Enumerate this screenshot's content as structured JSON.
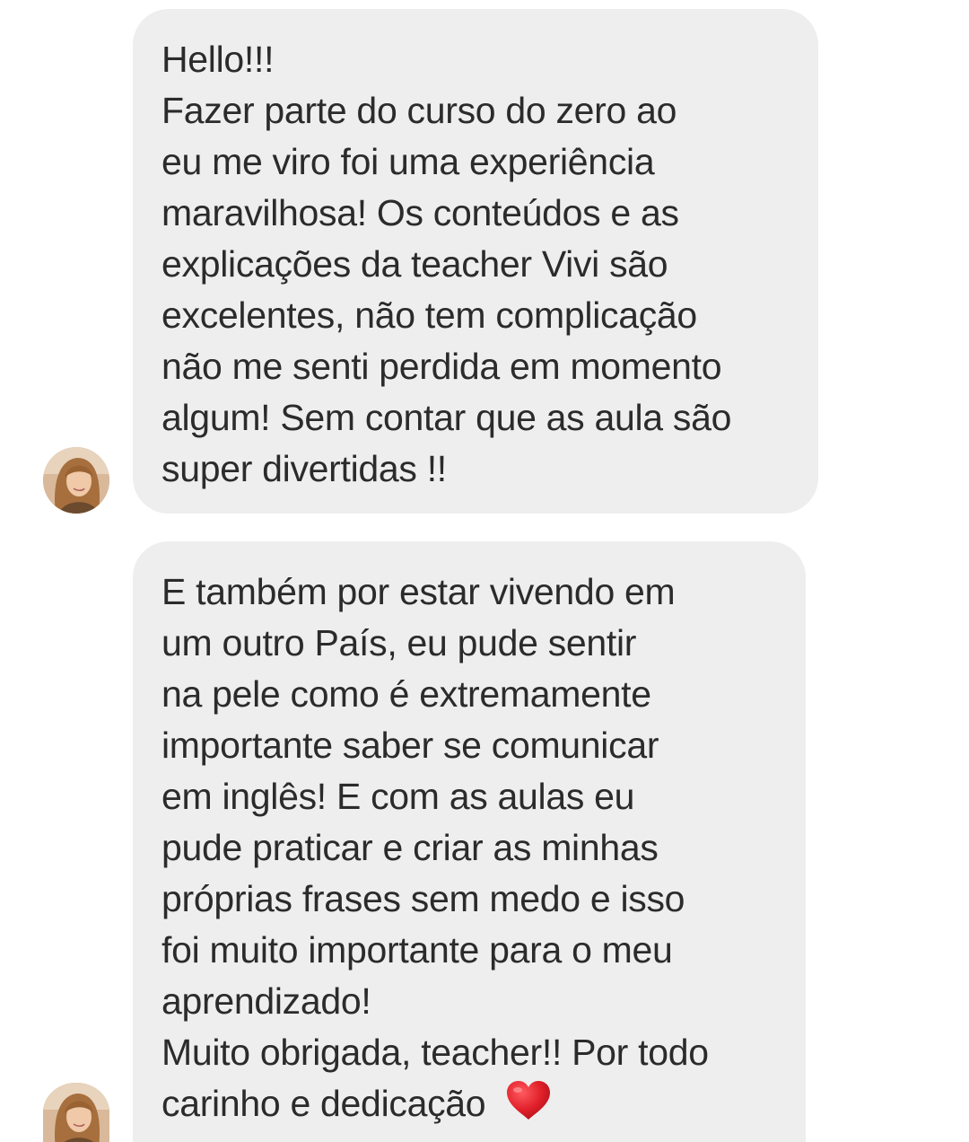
{
  "messages": [
    {
      "lines": [
        "Hello!!!",
        "Fazer parte do curso do zero ao",
        "eu me viro foi uma experiência",
        "maravilhosa! Os conteúdos e as",
        "explicações da teacher Vivi são",
        "excelentes, não tem complicação",
        "não me senti perdida em momento",
        "algum! Sem contar que as aula são",
        "super divertidas !!"
      ]
    },
    {
      "lines": [
        "E também por estar vivendo em",
        "um outro País, eu pude sentir",
        "na pele como é extremamente",
        "importante saber se comunicar",
        "em inglês! E com as aulas eu",
        "pude praticar e criar as minhas",
        "próprias frases sem medo e isso",
        "foi muito importante para o meu",
        "aprendizado!",
        "Muito obrigada, teacher!! Por todo",
        "carinho e dedicação"
      ],
      "trailing_icon": "red-heart-emoji"
    }
  ],
  "avatar_icon": "user-avatar-photo",
  "colors": {
    "bubble_background": "#eeeeee",
    "text": "#2b2b2b",
    "heart": "#e0202a",
    "page_background": "#ffffff"
  }
}
